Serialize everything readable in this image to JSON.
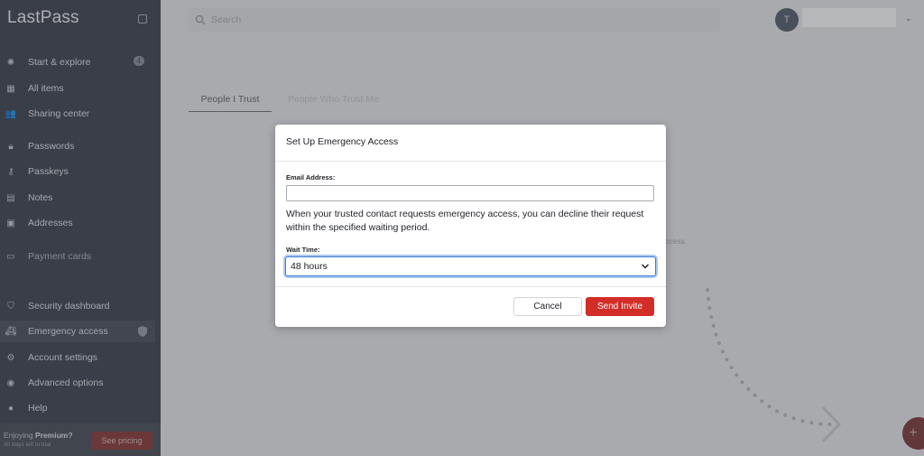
{
  "app": {
    "logo": "LastPass"
  },
  "sidebar": {
    "items": [
      {
        "label": "Start & explore",
        "icon": "bulb-icon",
        "badge": "4"
      },
      {
        "label": "All items",
        "icon": "grid-icon"
      },
      {
        "label": "Sharing center",
        "icon": "people-icon"
      },
      {
        "label": "Passwords",
        "icon": "lock-icon"
      },
      {
        "label": "Passkeys",
        "icon": "passkey-icon"
      },
      {
        "label": "Notes",
        "icon": "note-icon"
      },
      {
        "label": "Addresses",
        "icon": "address-icon"
      },
      {
        "label": "Payment cards",
        "icon": "card-icon"
      },
      {
        "label": "Security dashboard",
        "icon": "shield-icon"
      },
      {
        "label": "Emergency access",
        "icon": "ambulance-icon",
        "active": true
      },
      {
        "label": "Account settings",
        "icon": "gear-icon"
      },
      {
        "label": "Advanced options",
        "icon": "advanced-icon"
      },
      {
        "label": "Help",
        "icon": "help-icon"
      }
    ],
    "promo": {
      "prefix": "Enjoying ",
      "highlight": "Premium?",
      "sub": "30 days left in trial",
      "button": "See pricing"
    }
  },
  "topbar": {
    "search_placeholder": "Search",
    "avatar_initial": "T"
  },
  "main": {
    "tabs": [
      "People I Trust",
      "People Who Trust Me"
    ],
    "background_fragment": "ccess."
  },
  "modal": {
    "title": "Set Up Emergency Access",
    "email_label": "Email Address:",
    "email_value": "",
    "helper_text": "When your trusted contact requests emergency access, you can decline their request within the specified waiting period.",
    "wait_label": "Wait Time:",
    "wait_value": "48 hours",
    "cancel_label": "Cancel",
    "send_label": "Send Invite"
  },
  "colors": {
    "sidebar_bg": "#3e4450",
    "primary_red": "#d32d27",
    "focus_blue": "#3d7fd6"
  }
}
